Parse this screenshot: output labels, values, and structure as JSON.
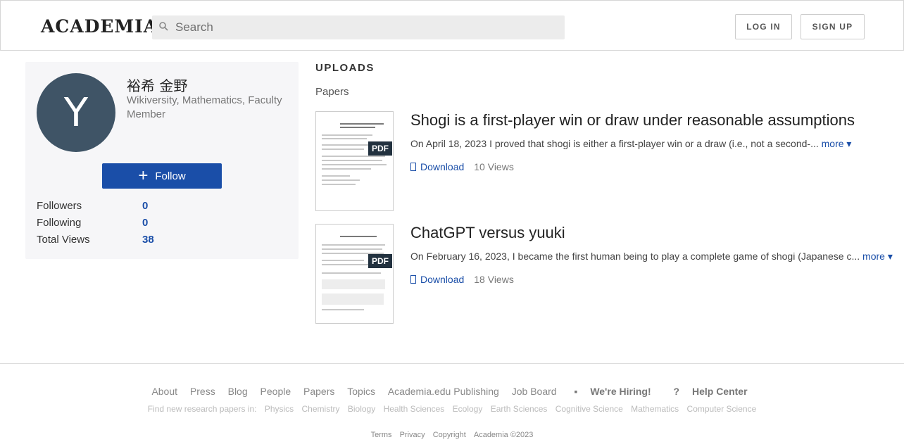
{
  "header": {
    "logo": "ACADEMIA",
    "search_placeholder": "Search",
    "login_label": "LOG IN",
    "signup_label": "SIGN UP"
  },
  "profile": {
    "avatar_letter": "Y",
    "name": "裕希 金野",
    "affiliations": [
      "Wikiversity",
      "Mathematics",
      "Faculty Member"
    ],
    "follow_label": "Follow",
    "stats": [
      {
        "label": "Followers",
        "value": "0"
      },
      {
        "label": "Following",
        "value": "0"
      },
      {
        "label": "Total Views",
        "value": "38"
      }
    ]
  },
  "uploads": {
    "title": "UPLOADS",
    "section_label": "Papers",
    "pdf_badge": "PDF",
    "papers": [
      {
        "title": "Shogi is a first-player win or draw under reasonable assumptions",
        "abstract": "On April 18, 2023 I proved that shogi is either a first-player win or a draw (i.e., not a second-...",
        "more_label": "more",
        "download_label": "Download",
        "views": "10 Views"
      },
      {
        "title": "ChatGPT versus yuuki",
        "abstract": "On February 16, 2023, I became the first human being to play a complete game of shogi (Japanese c...",
        "more_label": "more",
        "download_label": "Download",
        "views": "18 Views"
      }
    ]
  },
  "footer": {
    "links": [
      "About",
      "Press",
      "Blog",
      "People",
      "Papers",
      "Topics",
      "Academia.edu Publishing",
      "Job Board"
    ],
    "hiring": "We're Hiring!",
    "help": "Help Center",
    "topics_intro": "Find new research papers in:",
    "topics": [
      "Physics",
      "Chemistry",
      "Biology",
      "Health Sciences",
      "Ecology",
      "Earth Sciences",
      "Cognitive Science",
      "Mathematics",
      "Computer Science"
    ],
    "legal": [
      "Terms",
      "Privacy",
      "Copyright",
      "Academia ©2023"
    ]
  },
  "colors": {
    "accent": "#1a4ea8",
    "avatar_bg": "#3f5466"
  }
}
